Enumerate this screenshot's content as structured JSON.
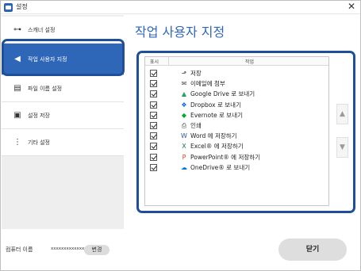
{
  "window": {
    "title": "설정",
    "close_glyph": "✕"
  },
  "sidebar": {
    "items": [
      {
        "label": "스캐너 설정",
        "icon": "scanner-cable-icon",
        "glyph": "⊶"
      },
      {
        "label": "작업 사용자 지정",
        "icon": "send-arrow-icon",
        "glyph": "◀",
        "active": true
      },
      {
        "label": "파일 이름 설정",
        "icon": "file-name-icon",
        "glyph": "▤"
      },
      {
        "label": "설정 저장",
        "icon": "save-settings-icon",
        "glyph": "▣"
      },
      {
        "label": "기타 설정",
        "icon": "more-options-icon",
        "glyph": "⋮"
      }
    ]
  },
  "main": {
    "title": "작업 사용자 지정",
    "list": {
      "header_show": "표시",
      "header_task": "작업",
      "rows": [
        {
          "label": "저장",
          "icon": "save-folder-icon",
          "glyph": "⬏",
          "color": "#444444",
          "checked": true
        },
        {
          "label": "이메일에 첨부",
          "icon": "email-icon",
          "glyph": "✉",
          "color": "#444444",
          "checked": true
        },
        {
          "label": "Google Drive 로 보내기",
          "icon": "google-drive-icon",
          "glyph": "▲",
          "color": "#1fa463",
          "checked": true
        },
        {
          "label": "Dropbox 로 보내기",
          "icon": "dropbox-icon",
          "glyph": "❖",
          "color": "#0061fe",
          "checked": true
        },
        {
          "label": "Evernote 로 보내기",
          "icon": "evernote-icon",
          "glyph": "◆",
          "color": "#00a82d",
          "checked": true
        },
        {
          "label": "인쇄",
          "icon": "printer-icon",
          "glyph": "⎙",
          "color": "#444444",
          "checked": true
        },
        {
          "label": "Word 에 저장하기",
          "icon": "word-icon",
          "glyph": "W",
          "color": "#2b579a",
          "checked": true
        },
        {
          "label": "Excel® 에 저장하기",
          "icon": "excel-icon",
          "glyph": "X",
          "color": "#217346",
          "checked": true
        },
        {
          "label": "PowerPoint® 에 저장하기",
          "icon": "powerpoint-icon",
          "glyph": "P",
          "color": "#d24726",
          "checked": true
        },
        {
          "label": "OneDrive® 로 보내기",
          "icon": "onedrive-icon",
          "glyph": "☁",
          "color": "#0078d4",
          "checked": true
        }
      ]
    },
    "move_up": {
      "icon": "arrow-up-icon",
      "glyph": "▲"
    },
    "move_down": {
      "icon": "arrow-down-icon",
      "glyph": "▼"
    }
  },
  "footer": {
    "computer_label": "컴퓨터 이름",
    "computer_name": "xxxxxxxxxxxxxxxx",
    "change_label": "변경",
    "close_label": "닫기"
  },
  "colors": {
    "accent": "#2f67b8",
    "highlight_ring": "#1f4e9a"
  }
}
